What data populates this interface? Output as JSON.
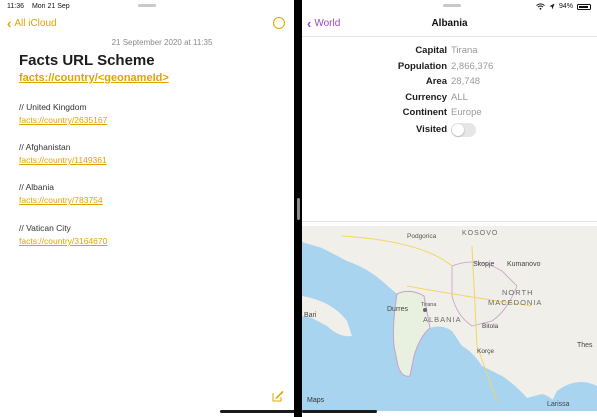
{
  "status": {
    "time": "11:36",
    "date": "Mon 21 Sep",
    "battery": "94%"
  },
  "notes": {
    "back_label": "All iCloud",
    "more_label": "···",
    "date": "21 September 2020 at 11:35",
    "title": "Facts URL Scheme",
    "scheme_link": "facts://country/<geonameId>",
    "entries": [
      {
        "comment": "// United Kingdom",
        "link": "facts://country/2635167"
      },
      {
        "comment": "// Afghanistan",
        "link": "facts://country/1149361"
      },
      {
        "comment": "// Albania",
        "link": "facts://country/783754"
      },
      {
        "comment": "// Vatican City",
        "link": "facts://country/3164670"
      }
    ]
  },
  "detail": {
    "back_label": "World",
    "title": "Albania",
    "fields": [
      {
        "key": "Capital",
        "value": "Tirana"
      },
      {
        "key": "Population",
        "value": "2,866,376"
      },
      {
        "key": "Area",
        "value": "28,748"
      },
      {
        "key": "Currency",
        "value": "ALL"
      },
      {
        "key": "Continent",
        "value": "Europe"
      }
    ],
    "visited_label": "Visited",
    "visited": false
  },
  "map": {
    "attribution": "Maps",
    "labels": {
      "kosovo": "KOSOVO",
      "podgorica": "Podgorica",
      "skopje": "Skopje",
      "kumanovo": "Kumanovo",
      "north": "NORTH",
      "macedonia": "MACEDONIA",
      "bari": "Bari",
      "durres": "Durres",
      "albania": "ALBANIA",
      "bitola": "Bitola",
      "korce": "Korçe",
      "thes": "Thes",
      "larissa": "Larissa",
      "tirana": "Tirana"
    }
  },
  "colors": {
    "notes_accent": "#e0a400",
    "app_accent": "#9b46c4",
    "sea": "#a8d4f0",
    "land": "#f1efe9"
  }
}
